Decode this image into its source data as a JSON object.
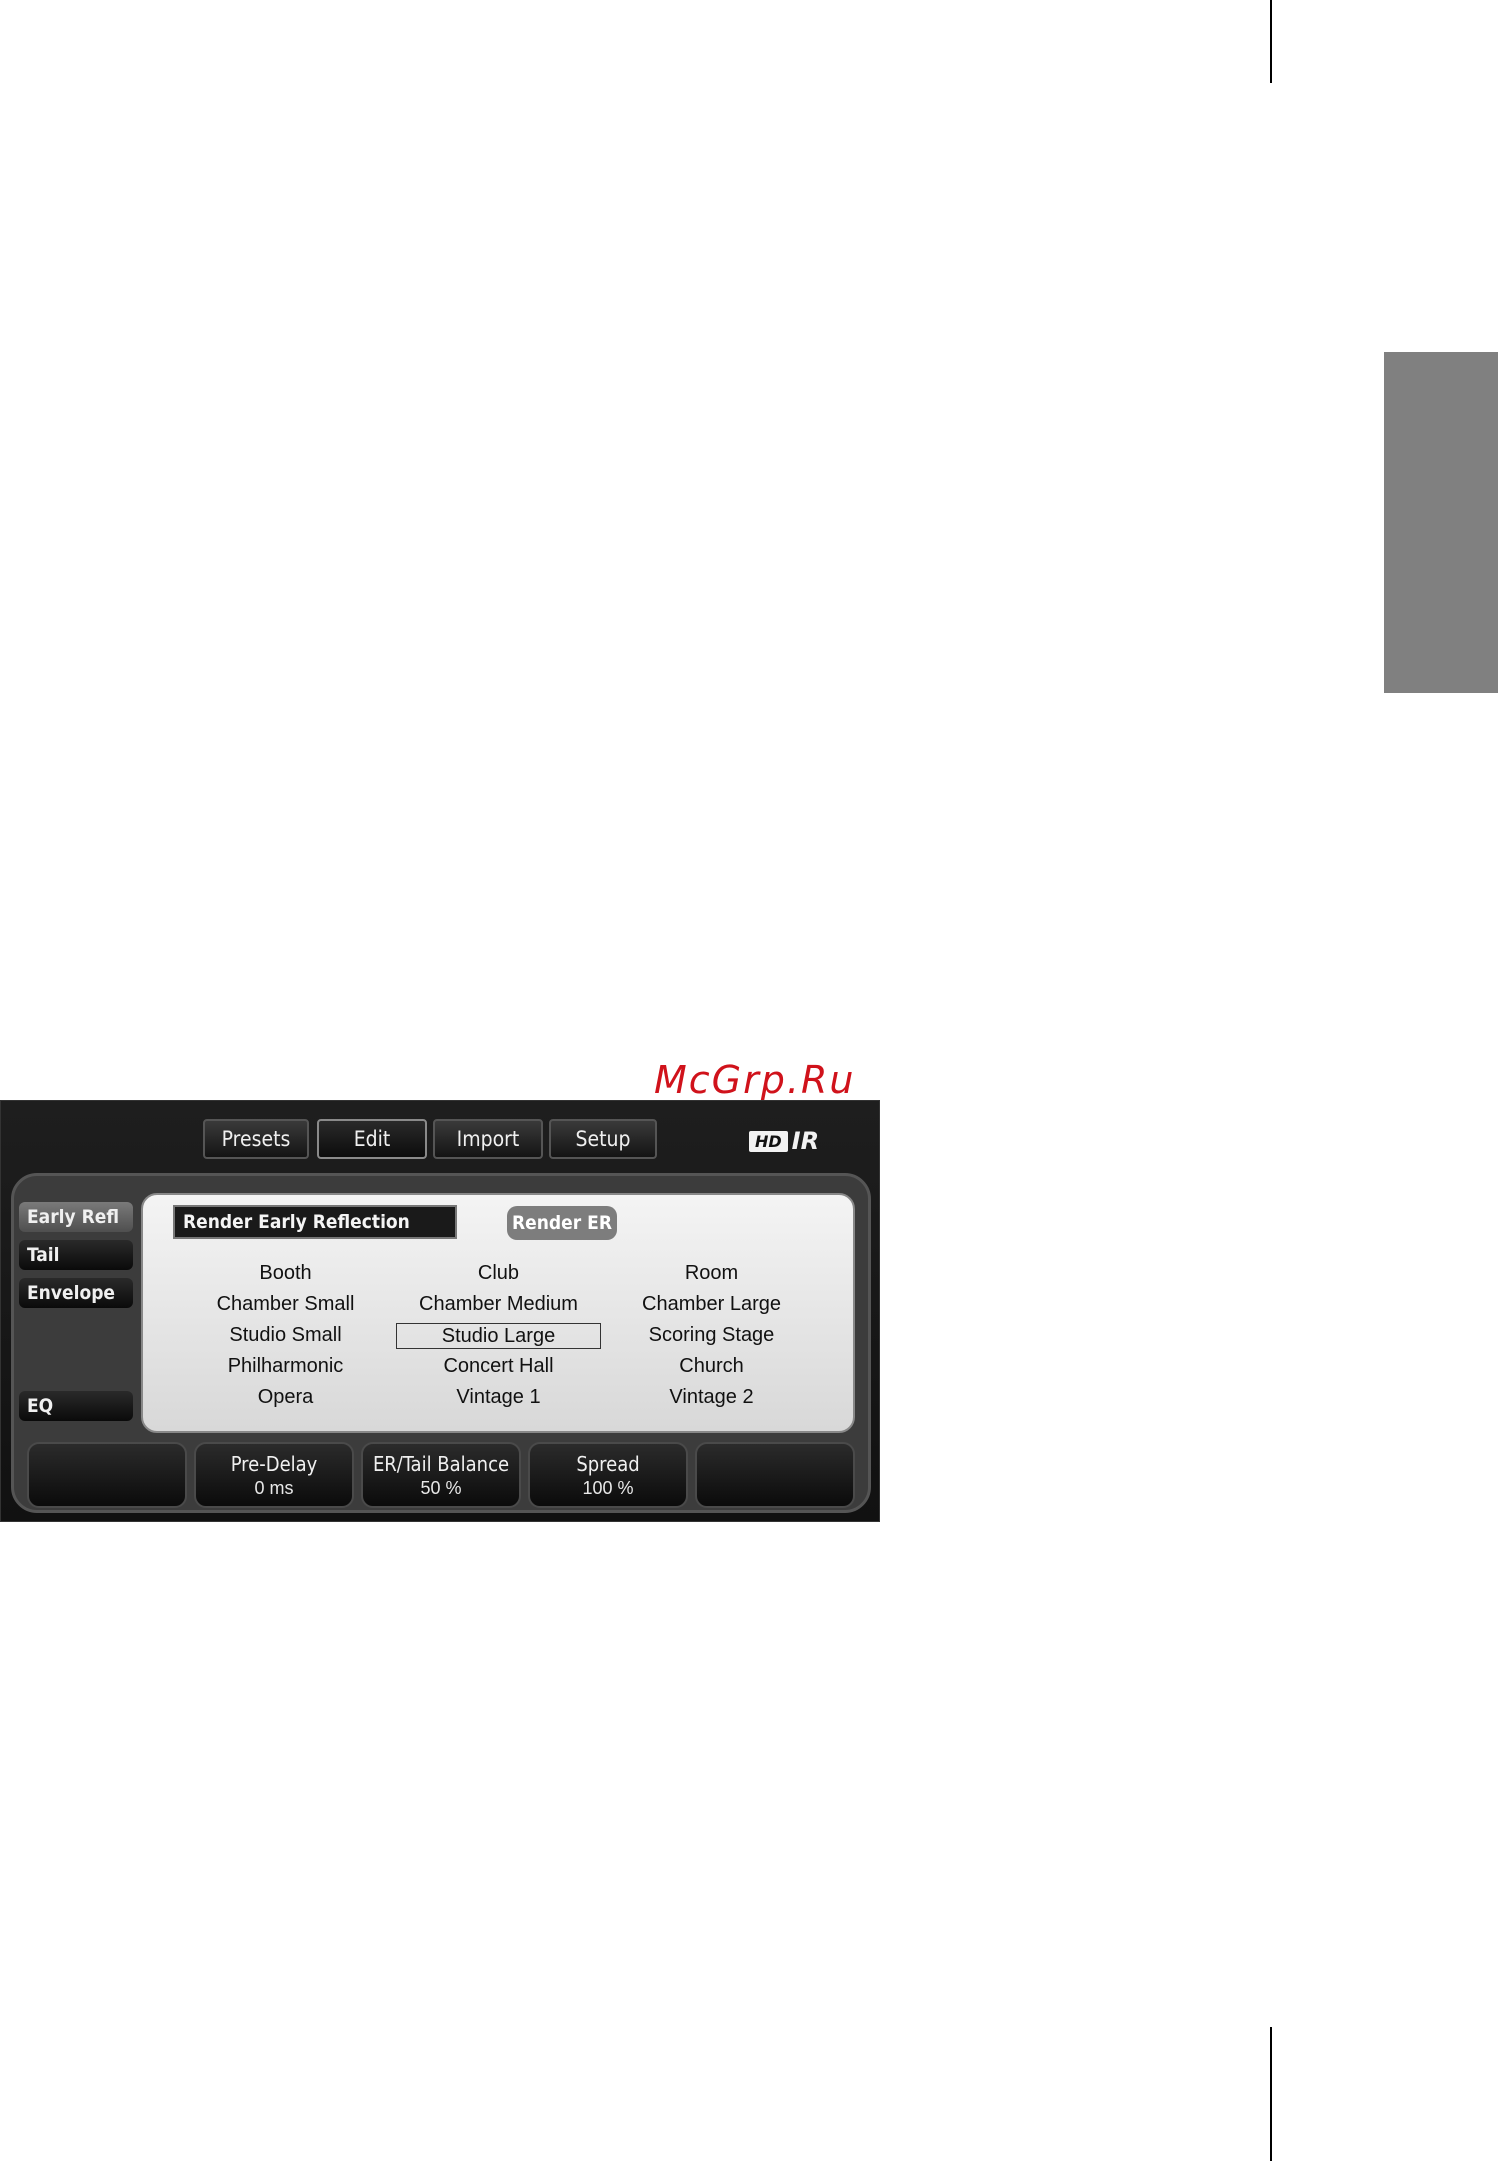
{
  "watermark": "McGrp.Ru",
  "toolbar": {
    "buttons": [
      {
        "label": "Presets"
      },
      {
        "label": "Edit"
      },
      {
        "label": "Import"
      },
      {
        "label": "Setup"
      }
    ],
    "active": "Edit",
    "logo": {
      "hd": "HD",
      "ir": "IR"
    }
  },
  "sidebar": {
    "items": [
      {
        "label": "Early Refl",
        "active": true
      },
      {
        "label": "Tail",
        "active": false
      },
      {
        "label": "Envelope",
        "active": false
      },
      {
        "label": "EQ",
        "active": false
      }
    ]
  },
  "panel": {
    "title": "Render Early Reflection",
    "render_button": "Render ER",
    "rooms": [
      "Booth",
      "Club",
      "Room",
      "Chamber Small",
      "Chamber Medium",
      "Chamber Large",
      "Studio Small",
      "Studio Large",
      "Scoring Stage",
      "Philharmonic",
      "Concert Hall",
      "Church",
      "Opera",
      "Vintage 1",
      "Vintage 2"
    ],
    "selected_room": "Studio Large"
  },
  "controls": [
    {
      "label": "",
      "value": ""
    },
    {
      "label": "Pre-Delay",
      "value": "0 ms"
    },
    {
      "label": "ER/Tail Balance",
      "value": "50 %"
    },
    {
      "label": "Spread",
      "value": "100 %"
    },
    {
      "label": "",
      "value": ""
    }
  ],
  "colors": {
    "watermark": "#d0121b",
    "side_tab": "#808080"
  }
}
